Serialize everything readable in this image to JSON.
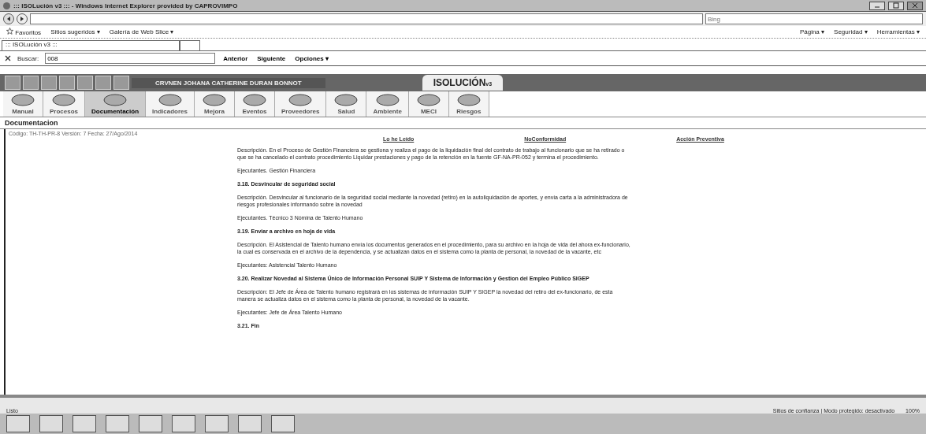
{
  "window": {
    "title": "::: ISOLución v3 ::: - Windows Internet Explorer provided by CAPROVIMPO"
  },
  "address_bar": {
    "search_placeholder": "Bing"
  },
  "favorites_bar": {
    "label": "Favoritos",
    "items": [
      "Sitios sugeridos ▾",
      "Galería de Web Slice ▾"
    ]
  },
  "tab": {
    "title": "::: ISOLución v3 :::"
  },
  "command_bar": {
    "items": [
      "Página ▾",
      "Seguridad ▾",
      "Herramientas ▾"
    ]
  },
  "find_bar": {
    "label": "Buscar:",
    "value": "008",
    "buttons": [
      "Anterior",
      "Siguiente"
    ],
    "options": "Opciones ▾"
  },
  "app_header": {
    "user": "CRVNEN JOHANA CATHERINE DURAN BONNOT",
    "logo": "ISOLUCIÓN",
    "logo_suffix": "v3"
  },
  "modules": [
    {
      "label": "Manual",
      "selected": false
    },
    {
      "label": "Procesos",
      "selected": false
    },
    {
      "label": "Documentación",
      "selected": true
    },
    {
      "label": "Indicadores",
      "selected": false
    },
    {
      "label": "Mejora",
      "selected": false
    },
    {
      "label": "Eventos",
      "selected": false
    },
    {
      "label": "Proveedores",
      "selected": false
    },
    {
      "label": "Salud",
      "selected": false
    },
    {
      "label": "Ambiente",
      "selected": false
    },
    {
      "label": "MECI",
      "selected": false
    },
    {
      "label": "Riesgos",
      "selected": false
    }
  ],
  "section": {
    "title": "Documentacion",
    "meta": "Código: TH-TH-PR-8   Versión: 7   Fecha: 27/Ago/2014"
  },
  "actions": [
    "Lo he Leído",
    "NoConformidad",
    "Acción Preventiva"
  ],
  "content": [
    {
      "kind": "para",
      "text": "Descripción. En el Proceso de Gestión Financiera se gestiona y realiza el pago de la liquidación final del contrato de trabajo al funcionario que se ha retirado o que se ha cancelado el contrato procedimiento Liquidar prestaciones y pago de la retención en la fuente GF-NA-PR-052 y termina el procedimiento."
    },
    {
      "kind": "para",
      "text": "Ejecutantes. Gestión Financiera"
    },
    {
      "kind": "heading",
      "text": "3.18. Desvincular de seguridad social"
    },
    {
      "kind": "para",
      "text": "Descripción. Desvincular al funcionario de la seguridad social mediante la novedad (retiro) en la autoliquidación de aportes, y envía carta a la administradora de riesgos profesionales informando sobre la novedad"
    },
    {
      "kind": "para",
      "text": "Ejecutantes. Técnico 3 Nómina de Talento Humano"
    },
    {
      "kind": "heading",
      "text": "3.19. Enviar a archivo en hoja de vida"
    },
    {
      "kind": "para",
      "text": "Descripción. El Asistencial de Talento humano envía los documentos generados en el procedimiento, para su archivo en la hoja de vida del ahora ex-funcionario, la cual es conservada en el archivo de la dependencia, y se actualizan datos en el sistema como la planta de personal, la novedad de la vacante, etc"
    },
    {
      "kind": "para",
      "text": "Ejecutantes: Asistencial Talento Humano"
    },
    {
      "kind": "heading",
      "text": "3.20. Realizar Novedad al Sistema Único de Información Personal SUIP Y Sistema de Información y Gestion del Empleo Público SIGEP"
    },
    {
      "kind": "para",
      "text": "Descripción: El Jefe de Área de Talento humano registrará en los sistemas de información SUIP Y SIGEP la novedad del retiro del ex-funcionario, de esta manera se actualiza datos en el sistema como la planta de personal, la novedad de la vacante."
    },
    {
      "kind": "para",
      "text": "Ejecutantes: Jefe de Área Talento Humano"
    },
    {
      "kind": "heading",
      "text": "3.21. Fin"
    }
  ],
  "status_bar": {
    "left": "Listo",
    "zone": "Sitios de confianza | Modo protegido: desactivado",
    "zoom": "100%"
  }
}
